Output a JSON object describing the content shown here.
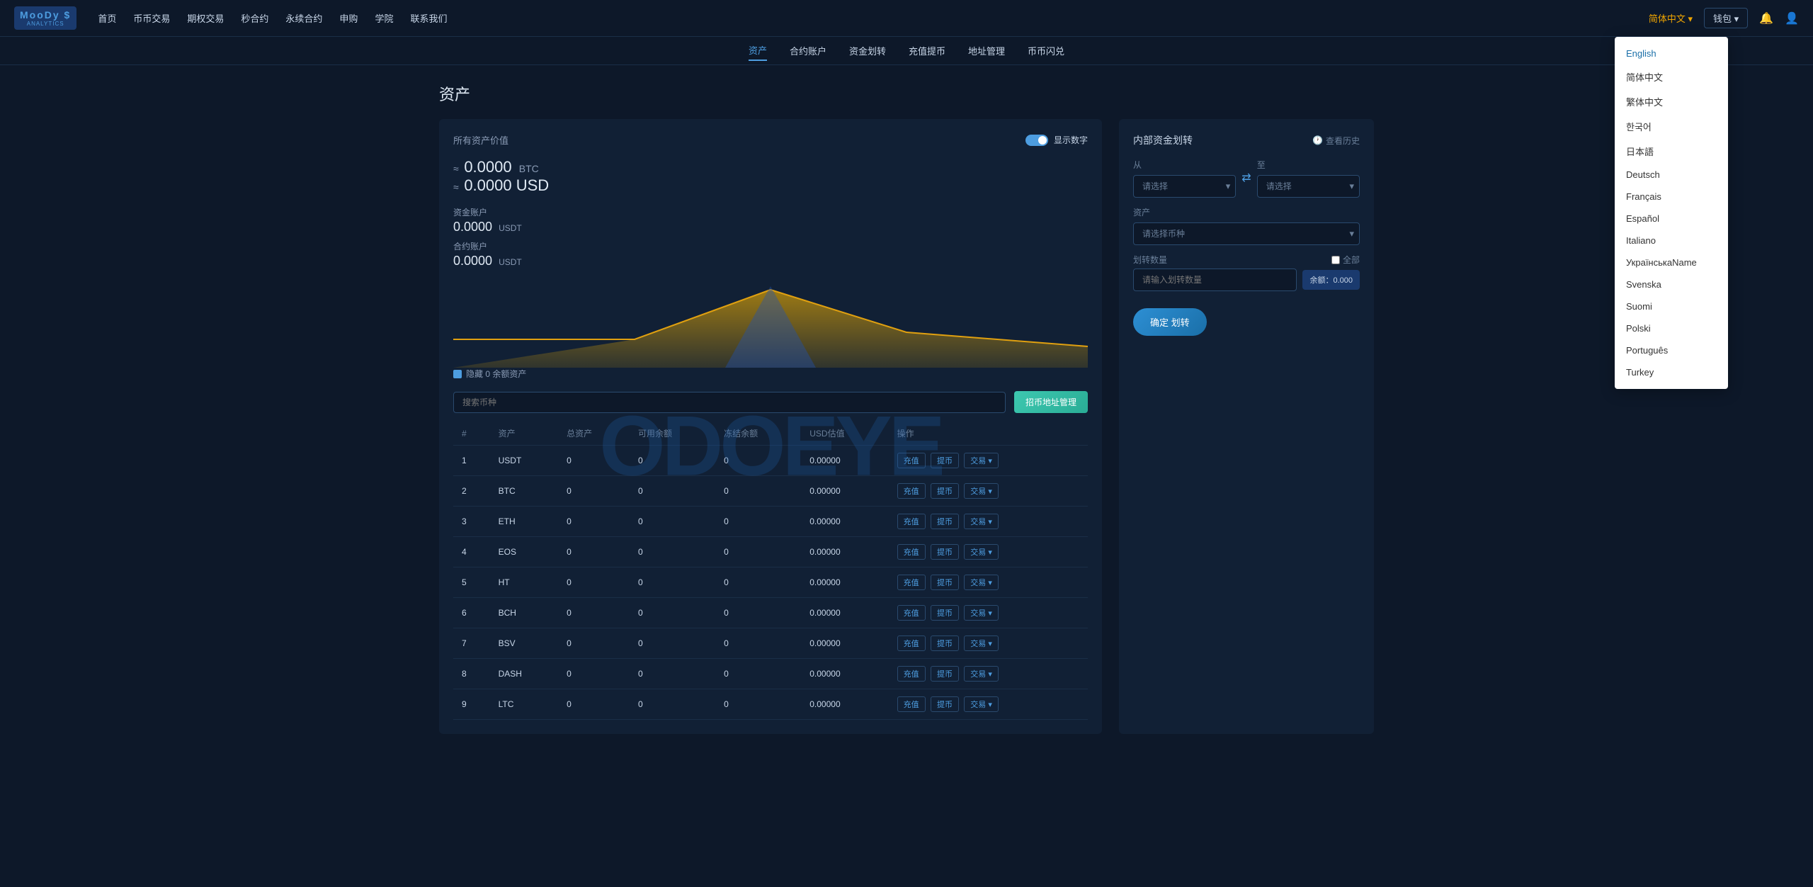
{
  "logo": {
    "brand": "MooDy $",
    "sub": "ANALYTICS"
  },
  "topNav": {
    "items": [
      "首页",
      "币币交易",
      "期权交易",
      "秒合约",
      "永续合约",
      "申购",
      "学院",
      "联系我们"
    ]
  },
  "langButton": "简体中文 ▾",
  "walletButton": "钱包 ▾",
  "secondNav": {
    "items": [
      "资产",
      "合约账户",
      "资金划转",
      "充值提币",
      "地址管理",
      "币币闪兑"
    ],
    "active": 0
  },
  "pageTitle": "资产",
  "leftPanel": {
    "allAssetsLabel": "所有资产价值",
    "toggleLabel": "显示数字",
    "btcValue": "0.0000",
    "btcUnit": "BTC",
    "usdValue": "0.0000",
    "usdUnit": "USD",
    "fundAccount": {
      "label": "资金账户",
      "value": "0.0000",
      "unit": "USDT"
    },
    "contractAccount": {
      "label": "合约账户",
      "value": "0.0000",
      "unit": "USDT"
    },
    "hideZeroLabel": "隐藏 0 余额资产"
  },
  "searchBar": {
    "placeholder": "搜索币种",
    "coinAddressBtn": "招币地址管理"
  },
  "tableHeaders": [
    "#",
    "资产",
    "总资产",
    "可用余额",
    "冻结余额",
    "USD估值",
    "操作"
  ],
  "tableRows": [
    {
      "num": 1,
      "asset": "USDT",
      "total": "0",
      "available": "0",
      "frozen": "0",
      "usd": "0.00000"
    },
    {
      "num": 2,
      "asset": "BTC",
      "total": "0",
      "available": "0",
      "frozen": "0",
      "usd": "0.00000"
    },
    {
      "num": 3,
      "asset": "ETH",
      "total": "0",
      "available": "0",
      "frozen": "0",
      "usd": "0.00000"
    },
    {
      "num": 4,
      "asset": "EOS",
      "total": "0",
      "available": "0",
      "frozen": "0",
      "usd": "0.00000"
    },
    {
      "num": 5,
      "asset": "HT",
      "total": "0",
      "available": "0",
      "frozen": "0",
      "usd": "0.00000"
    },
    {
      "num": 6,
      "asset": "BCH",
      "total": "0",
      "available": "0",
      "frozen": "0",
      "usd": "0.00000"
    },
    {
      "num": 7,
      "asset": "BSV",
      "total": "0",
      "available": "0",
      "frozen": "0",
      "usd": "0.00000"
    },
    {
      "num": 8,
      "asset": "DASH",
      "total": "0",
      "available": "0",
      "frozen": "0",
      "usd": "0.00000"
    },
    {
      "num": 9,
      "asset": "LTC",
      "total": "0",
      "available": "0",
      "frozen": "0",
      "usd": "0.00000"
    }
  ],
  "actionButtons": {
    "deposit": "充值",
    "withdraw": "提币",
    "exchange": "交易 ▾"
  },
  "rightPanel": {
    "title": "内部资金划转",
    "historyLink": "查看历史",
    "fromLabel": "从",
    "toLabel": "至",
    "fromPlaceholder": "请选择",
    "toPlaceholder": "请选择",
    "assetLabel": "资产",
    "assetPlaceholder": "请选择币种",
    "transferAmountLabel": "划转数量",
    "allLabel": "全部",
    "amountPlaceholder": "请输入划转数量",
    "balancePrefix": "余额：",
    "balanceValue": "0.000",
    "confirmBtn": "确定 划转"
  },
  "watermark": "ODOEYE",
  "langDropdown": {
    "options": [
      "English",
      "简体中文",
      "繁体中文",
      "한국어",
      "日本語",
      "Deutsch",
      "Français",
      "Español",
      "Italiano",
      "УкраїнськаName",
      "Svenska",
      "Suomi",
      "Polski",
      "Português",
      "Turkey"
    ],
    "selected": "English"
  }
}
